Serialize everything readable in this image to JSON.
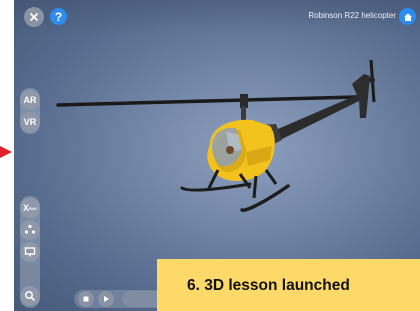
{
  "header": {
    "model_title": "Robinson R22 helicopter",
    "help_label": "?",
    "close_icon": "close-icon",
    "home_icon": "home-icon"
  },
  "sidebar": {
    "ar_label": "AR",
    "vr_label": "VR",
    "xray_label": "X",
    "xray_sub": "RAY",
    "explode_icon": "explode-icon",
    "present_icon": "screen-icon",
    "search_icon": "search-icon"
  },
  "playback": {
    "stop_icon": "stop-icon",
    "play_icon": "play-icon"
  },
  "caption": {
    "text": "6. 3D lesson launched"
  },
  "colors": {
    "background": "#6f83a4",
    "helicopter_body": "#f3c21c",
    "caption_bg": "#fdd969",
    "accent": "#2d8cf0",
    "pointer": "#e0202a"
  }
}
